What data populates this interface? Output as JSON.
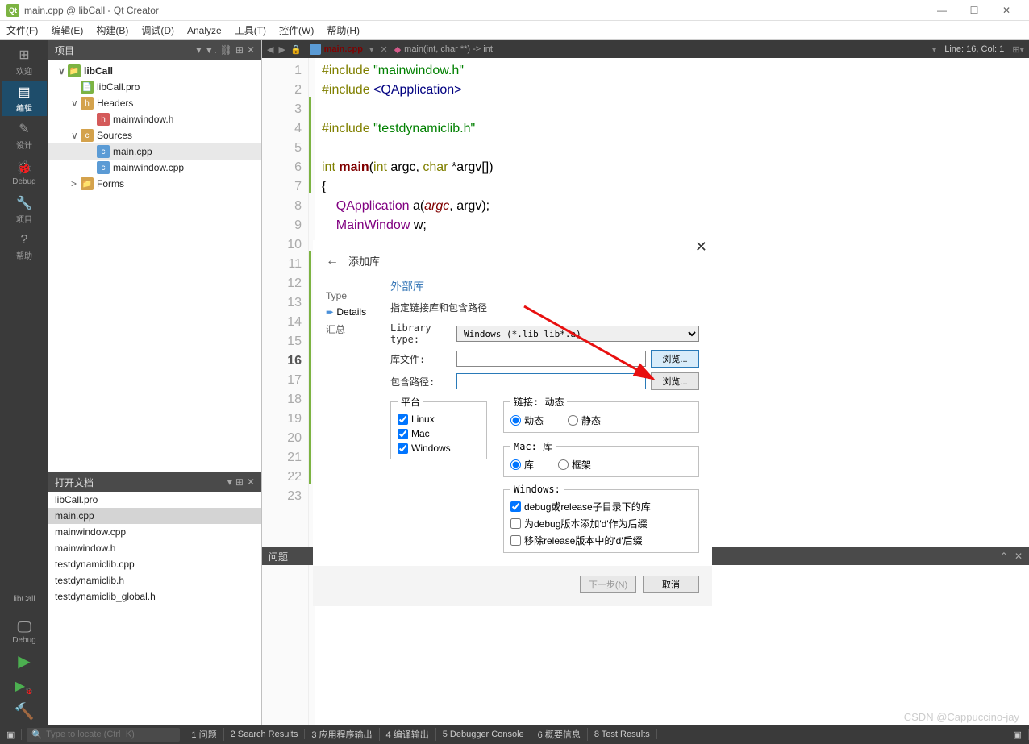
{
  "window": {
    "title": "main.cpp @ libCall - Qt Creator"
  },
  "menubar": [
    "文件(F)",
    "编辑(E)",
    "构建(B)",
    "调试(D)",
    "Analyze",
    "工具(T)",
    "控件(W)",
    "帮助(H)"
  ],
  "leftbar": {
    "items": [
      {
        "label": "欢迎",
        "icon": "⊞"
      },
      {
        "label": "编辑",
        "icon": "▤",
        "active": true
      },
      {
        "label": "设计",
        "icon": "✎"
      },
      {
        "label": "Debug",
        "icon": "🐞"
      },
      {
        "label": "项目",
        "icon": "🔧"
      },
      {
        "label": "帮助",
        "icon": "?"
      }
    ],
    "kit": {
      "name": "libCall",
      "mode": "Debug",
      "screen": "□"
    }
  },
  "project": {
    "title": "项目",
    "root": "libCall",
    "items": [
      {
        "label": "libCall",
        "bold": true,
        "chev": "∨",
        "ind": 0,
        "icon": "📁",
        "iconColor": "#7cb342"
      },
      {
        "label": "libCall.pro",
        "ind": 1,
        "icon": "📄",
        "iconColor": "#7cb342"
      },
      {
        "label": "Headers",
        "chev": "∨",
        "ind": 1,
        "icon": "h",
        "iconColor": "#d4a24c"
      },
      {
        "label": "mainwindow.h",
        "ind": 2,
        "icon": "h",
        "iconColor": "#d45a5a"
      },
      {
        "label": "Sources",
        "chev": "∨",
        "ind": 1,
        "icon": "c",
        "iconColor": "#d4a24c"
      },
      {
        "label": "main.cpp",
        "ind": 2,
        "icon": "c",
        "iconColor": "#5b9bd5",
        "sel": true
      },
      {
        "label": "mainwindow.cpp",
        "ind": 2,
        "icon": "c",
        "iconColor": "#5b9bd5"
      },
      {
        "label": "Forms",
        "chev": ">",
        "ind": 1,
        "icon": "📁",
        "iconColor": "#d4a24c"
      }
    ]
  },
  "opendocs": {
    "title": "打开文档",
    "items": [
      "libCall.pro",
      "main.cpp",
      "mainwindow.cpp",
      "mainwindow.h",
      "testdynamiclib.cpp",
      "testdynamiclib.h",
      "testdynamiclib_global.h"
    ],
    "selected": "main.cpp"
  },
  "editor": {
    "tab": {
      "file": "main.cpp",
      "sig": "main(int, char **) -> int",
      "line": "Line: 16, Col: 1"
    },
    "lines": [
      1,
      2,
      3,
      4,
      5,
      6,
      7,
      8,
      9,
      10,
      11,
      12,
      13,
      14,
      15,
      16,
      17,
      18,
      19,
      20,
      21,
      22,
      23
    ],
    "current": 16,
    "marks": [
      1,
      2,
      3,
      4,
      5,
      6,
      7,
      8,
      9,
      10,
      11,
      12,
      13,
      14,
      15,
      16,
      17,
      18,
      19,
      20,
      21,
      22,
      23
    ],
    "code": {
      "l1": {
        "pre": "#include ",
        "str": "\"mainwindow.h\""
      },
      "l2": {
        "pre": "#include ",
        "inc": "<QApplication>"
      },
      "l4": {
        "pre": "#include ",
        "str": "\"testdynamiclib.h\""
      },
      "l6": {
        "t": "int main(int argc, char *argv[])"
      },
      "l7": "{",
      "l8": {
        "p": "    ",
        "t": "QApplication a(argc, argv);"
      },
      "l9": {
        "p": "    ",
        "t": "MainWindow w;"
      }
    }
  },
  "problems": {
    "title": "问题"
  },
  "statusbar": {
    "search": "Type to locate (Ctrl+K)",
    "items": [
      "1 问题",
      "2 Search Results",
      "3 应用程序输出",
      "4 编译输出",
      "5 Debugger Console",
      "6 概要信息",
      "8 Test Results"
    ]
  },
  "dialog": {
    "title": "添加库",
    "steps": {
      "type": "Type",
      "details": "Details",
      "summary": "汇总"
    },
    "header": "外部库",
    "sub": "指定链接库和包含路径",
    "labels": {
      "libtype": "Library type:",
      "libfile": "库文件:",
      "incpath": "包含路径:",
      "platform": "平台",
      "link": "链接: 动态",
      "mac": "Mac: 库",
      "win": "Windows:"
    },
    "libtype_val": "Windows (*.lib lib*.a)",
    "browse": "浏览...",
    "platforms": {
      "linux": "Linux",
      "mac": "Mac",
      "windows": "Windows"
    },
    "link": {
      "dynamic": "动态",
      "static": "静态"
    },
    "maclink": {
      "lib": "库",
      "framework": "框架"
    },
    "winopts": {
      "o1": "debug或release子目录下的库",
      "o2": "为debug版本添加'd'作为后缀",
      "o3": "移除release版本中的'd'后缀"
    },
    "footer": {
      "next": "下一步(N)",
      "cancel": "取消"
    }
  },
  "watermark": "CSDN @Cappuccino-jay"
}
